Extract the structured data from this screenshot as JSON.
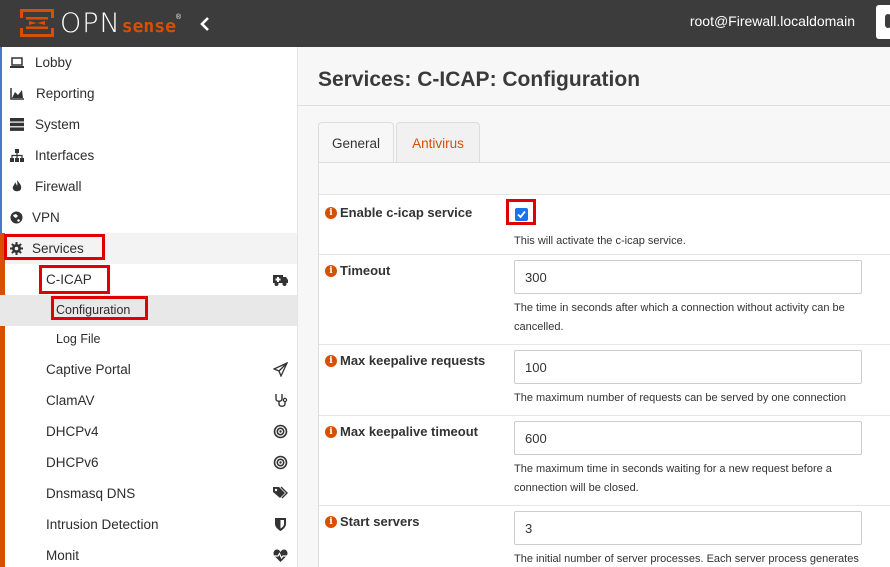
{
  "header": {
    "logo_text": "OPN",
    "logo_sense": "sense",
    "logo_reg": "®",
    "user": "root@Firewall.localdomain"
  },
  "sidebar": {
    "items": [
      {
        "label": "Lobby",
        "icon": "laptop-icon"
      },
      {
        "label": "Reporting",
        "icon": "area-chart-icon"
      },
      {
        "label": "System",
        "icon": "server-icon"
      },
      {
        "label": "Interfaces",
        "icon": "sitemap-icon"
      },
      {
        "label": "Firewall",
        "icon": "fire-icon"
      },
      {
        "label": "VPN",
        "icon": "globe-icon"
      },
      {
        "label": "Services",
        "icon": "cog-icon"
      }
    ],
    "services_sub": {
      "cicap": {
        "label": "C-ICAP",
        "icon": "ambulance-icon"
      },
      "configuration": {
        "label": "Configuration"
      },
      "logfile": {
        "label": "Log File"
      },
      "items": [
        {
          "label": "Captive Portal",
          "icon": "paper-plane-icon"
        },
        {
          "label": "ClamAV",
          "icon": "stethoscope-icon"
        },
        {
          "label": "DHCPv4",
          "icon": "bullseye-icon"
        },
        {
          "label": "DHCPv6",
          "icon": "bullseye-icon"
        },
        {
          "label": "Dnsmasq DNS",
          "icon": "tags-icon"
        },
        {
          "label": "Intrusion Detection",
          "icon": "shield-icon"
        },
        {
          "label": "Monit",
          "icon": "heartbeat-icon"
        }
      ]
    }
  },
  "main": {
    "title": "Services: C-ICAP: Configuration",
    "tabs": [
      {
        "label": "General",
        "active": true
      },
      {
        "label": "Antivirus",
        "active": false
      }
    ],
    "fields": {
      "enable": {
        "label": "Enable c-icap service",
        "checked": true,
        "help": "This will activate the c-icap service."
      },
      "timeout": {
        "label": "Timeout",
        "value": "300",
        "help": "The time in seconds after which a connection without activity can be cancelled."
      },
      "max_keepalive_requests": {
        "label": "Max keepalive requests",
        "value": "100",
        "help": "The maximum number of requests can be served by one connection"
      },
      "max_keepalive_timeout": {
        "label": "Max keepalive timeout",
        "value": "600",
        "help": "The maximum time in seconds waiting for a new request before a connection will be closed."
      },
      "start_servers": {
        "label": "Start servers",
        "value": "3",
        "help": "The initial number of server processes. Each server process generates"
      }
    }
  },
  "colors": {
    "accent": "#d94f00",
    "topbar": "#3c3c3c",
    "highlight": "#e00000",
    "checkbox": "#1a73e8"
  }
}
